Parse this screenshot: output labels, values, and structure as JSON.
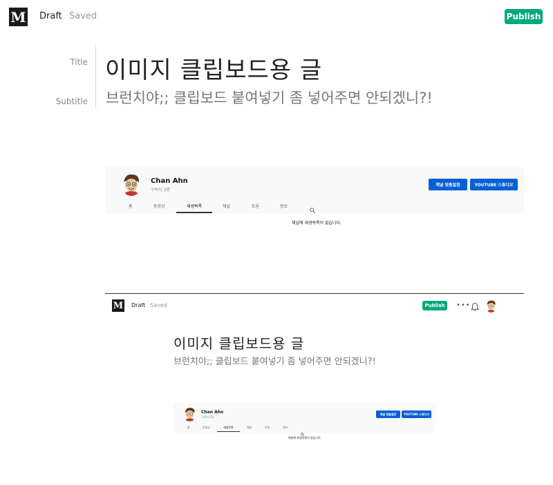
{
  "header": {
    "logo": "M",
    "status": "Draft",
    "saved": "Saved",
    "publish_label": "Publish"
  },
  "editor": {
    "title_label": "Title",
    "subtitle_label": "Subtitle",
    "title": "이미지 클립보드용 글",
    "subtitle": "브런치야;; 클립보드 붙여넣기 좀 넣어주면 안되겠니?!"
  },
  "youtube_embed": {
    "channel_name": "Chan Ahn",
    "subscribers": "구독자 2명",
    "customize_button": "채널 맞춤설정",
    "studio_button": "YOUTUBE 스튜디오",
    "tabs": [
      "홈",
      "동영상",
      "재생목록",
      "채널",
      "토론",
      "정보"
    ],
    "active_tab_index": 2,
    "search_icon": "search-icon",
    "empty_message": "채널에 재생목록이 없습니다."
  },
  "nested_editor": {
    "logo": "M",
    "status": "Draft",
    "saved": "Saved",
    "publish_label": "Publish",
    "more": "•••",
    "title": "이미지 클립보드용 글",
    "subtitle": "브런치야;; 클립보드 붙여넣기 좀 넣어주면 안되겠니?!"
  },
  "colors": {
    "publish_green": "#03a87c",
    "youtube_blue": "#065fd4"
  }
}
